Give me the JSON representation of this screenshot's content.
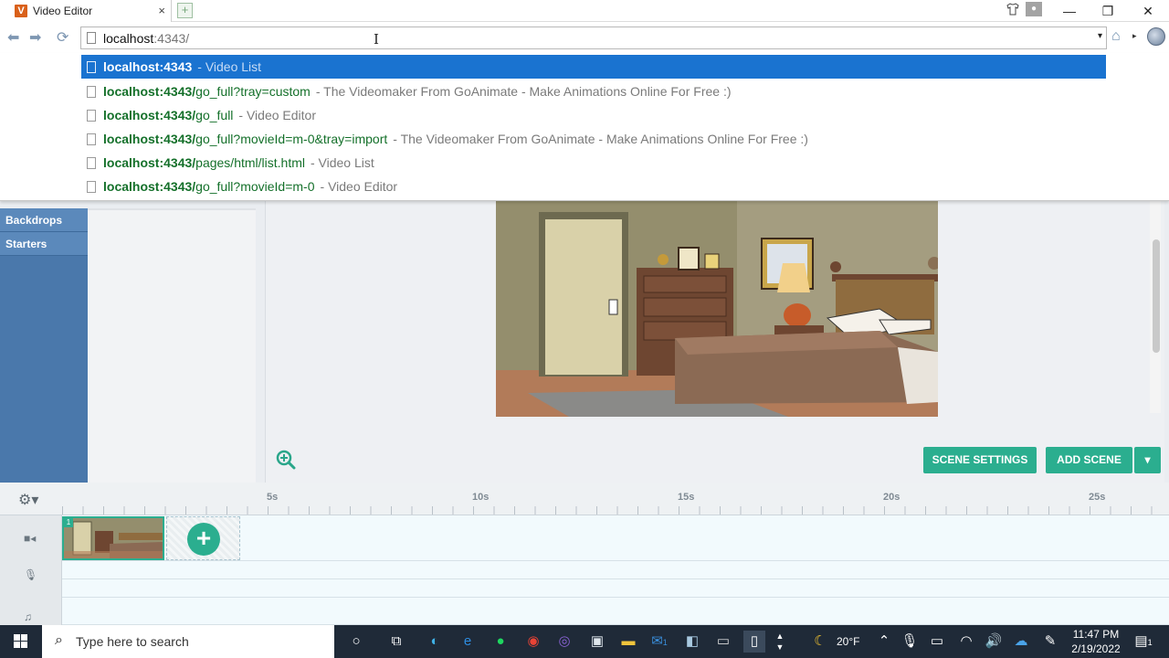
{
  "browser": {
    "tab_title": "Video Editor",
    "tab_favicon_letter": "V",
    "tab_close": "×",
    "new_tab": "+",
    "window_controls": {
      "minimize": "—",
      "restore": "❐",
      "close": "✕"
    }
  },
  "address_bar": {
    "host": "localhost",
    "rest": ":4343/",
    "dropdown_glyph": "▾"
  },
  "suggestions": [
    {
      "url_bold": "localhost:4343",
      "url_tail": "",
      "title": "- Video List",
      "selected": true
    },
    {
      "url_bold": "localhost:4343/",
      "url_tail": "go_full?tray=custom",
      "title": "- The Videomaker From GoAnimate - Make Animations Online For Free :)"
    },
    {
      "url_bold": "localhost:4343/",
      "url_tail": "go_full",
      "title": "- Video Editor"
    },
    {
      "url_bold": "localhost:4343/",
      "url_tail": "go_full?movieId=m-0&tray=import",
      "title": "- The Videomaker From GoAnimate - Make Animations Online For Free :)"
    },
    {
      "url_bold": "localhost:4343/",
      "url_tail": "pages/html/list.html",
      "title": "- Video List"
    },
    {
      "url_bold": "localhost:4343/",
      "url_tail": "go_full?movieId=m-0",
      "title": "- Video Editor"
    }
  ],
  "sidebar": {
    "items": [
      {
        "label": "Backdrops"
      },
      {
        "label": "Starters"
      }
    ]
  },
  "stage": {
    "buttons": {
      "scene_settings": "SCENE SETTINGS",
      "add_scene": "ADD SCENE",
      "add_scene_dropdown": "▾"
    }
  },
  "timeline": {
    "ticks": [
      "5s",
      "10s",
      "15s",
      "20s",
      "25s"
    ],
    "scene_number": "1",
    "add_glyph": "+"
  },
  "taskbar": {
    "search_placeholder": "Type here to search",
    "weather": "20°F",
    "time": "11:47 PM",
    "date": "2/19/2022",
    "notification_count": "1",
    "mail_badge": "1"
  },
  "colors": {
    "accent_teal": "#2bae8f",
    "sidebar_blue": "#4a78ab",
    "selected_blue": "#1a73d0",
    "url_green": "#14702a"
  }
}
